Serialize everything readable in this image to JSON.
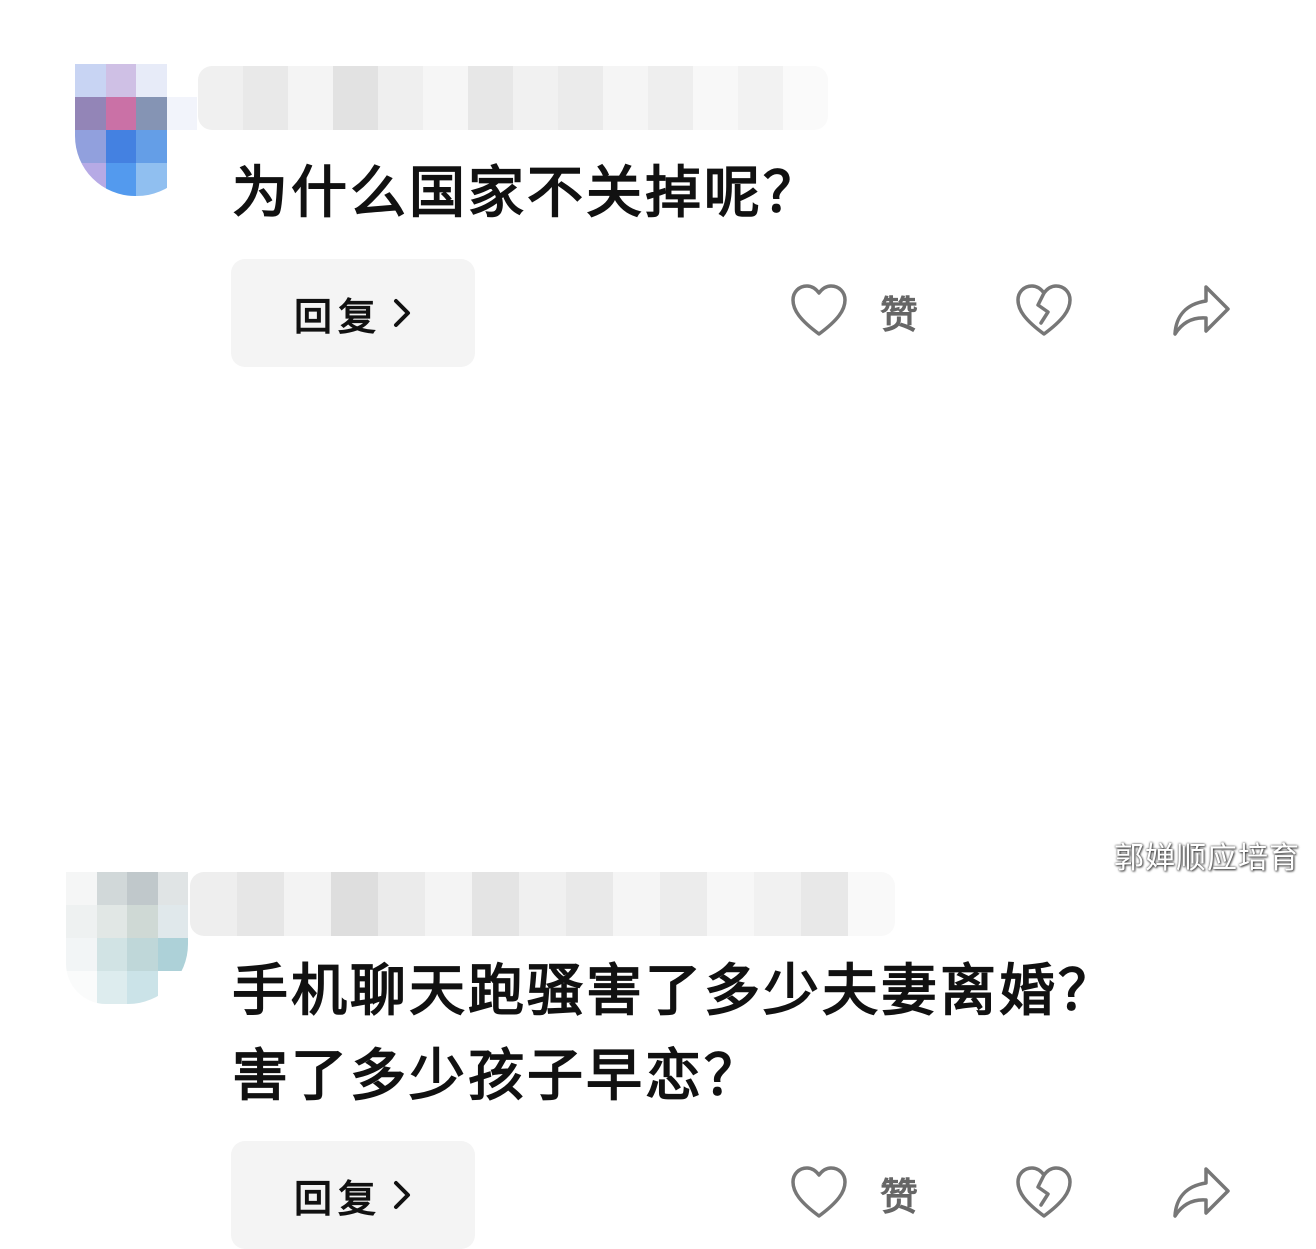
{
  "comments": [
    {
      "text": "为什么国家不关掉呢？",
      "reply_label": "回复",
      "like_label": "赞",
      "icons": {
        "like": "heart-outline-icon",
        "dislike": "broken-heart-icon",
        "share": "share-arrow-icon",
        "reply": "chevron-right-icon"
      }
    },
    {
      "text_line1": "手机聊天跑骚害了多少夫妻离婚？",
      "text_line2": "害了多少孩子早恋？",
      "reply_label": "回复",
      "like_label": "赞",
      "icons": {
        "like": "heart-outline-icon",
        "dislike": "broken-heart-icon",
        "share": "share-arrow-icon",
        "reply": "chevron-right-icon"
      }
    }
  ],
  "watermark": "郭婵顺应培育",
  "colors": {
    "button_bg": "#f4f4f4",
    "icon_stroke": "#777777",
    "text": "#111111"
  }
}
